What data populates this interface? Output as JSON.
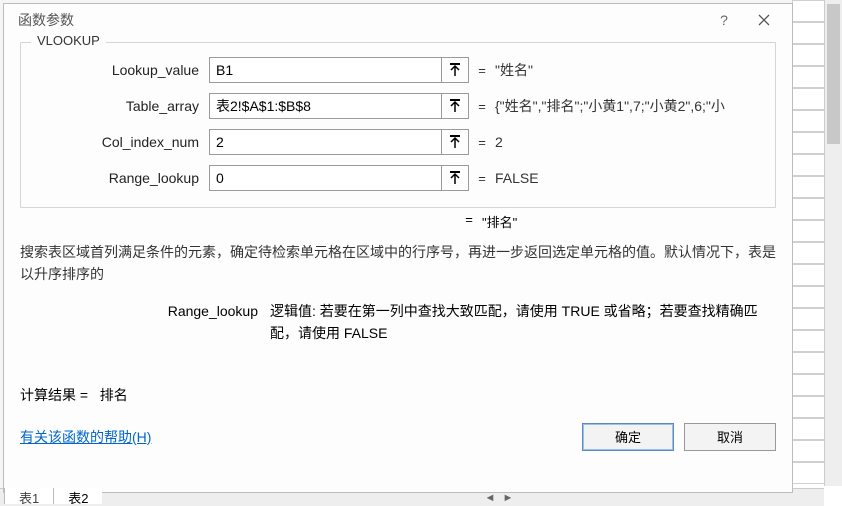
{
  "dialog": {
    "title": "函数参数",
    "group_title": "VLOOKUP",
    "params": [
      {
        "label": "Lookup_value",
        "value": "B1",
        "result": "\"姓名\""
      },
      {
        "label": "Table_array",
        "value": "表2!$A$1:$B$8",
        "result": "{\"姓名\",\"排名\";\"小黄1\",7;\"小黄2\",6;\"小"
      },
      {
        "label": "Col_index_num",
        "value": "2",
        "result": "2"
      },
      {
        "label": "Range_lookup",
        "value": "0",
        "result": "FALSE"
      }
    ],
    "func_eq": "=",
    "func_result": "\"排名\"",
    "description": "搜索表区域首列满足条件的元素，确定待检索单元格在区域中的行序号，再进一步返回选定单元格的值。默认情况下，表是以升序排序的",
    "param_help": {
      "name": "Range_lookup",
      "text": "逻辑值: 若要在第一列中查找大致匹配，请使用 TRUE 或省略；若要查找精确匹配，请使用 FALSE"
    },
    "calc_label": "计算结果 = ",
    "calc_value": "排名",
    "help_link": "有关该函数的帮助(H)",
    "ok": "确定",
    "cancel": "取消"
  },
  "sheets": {
    "tab1": "表1",
    "tab2": "表2"
  }
}
